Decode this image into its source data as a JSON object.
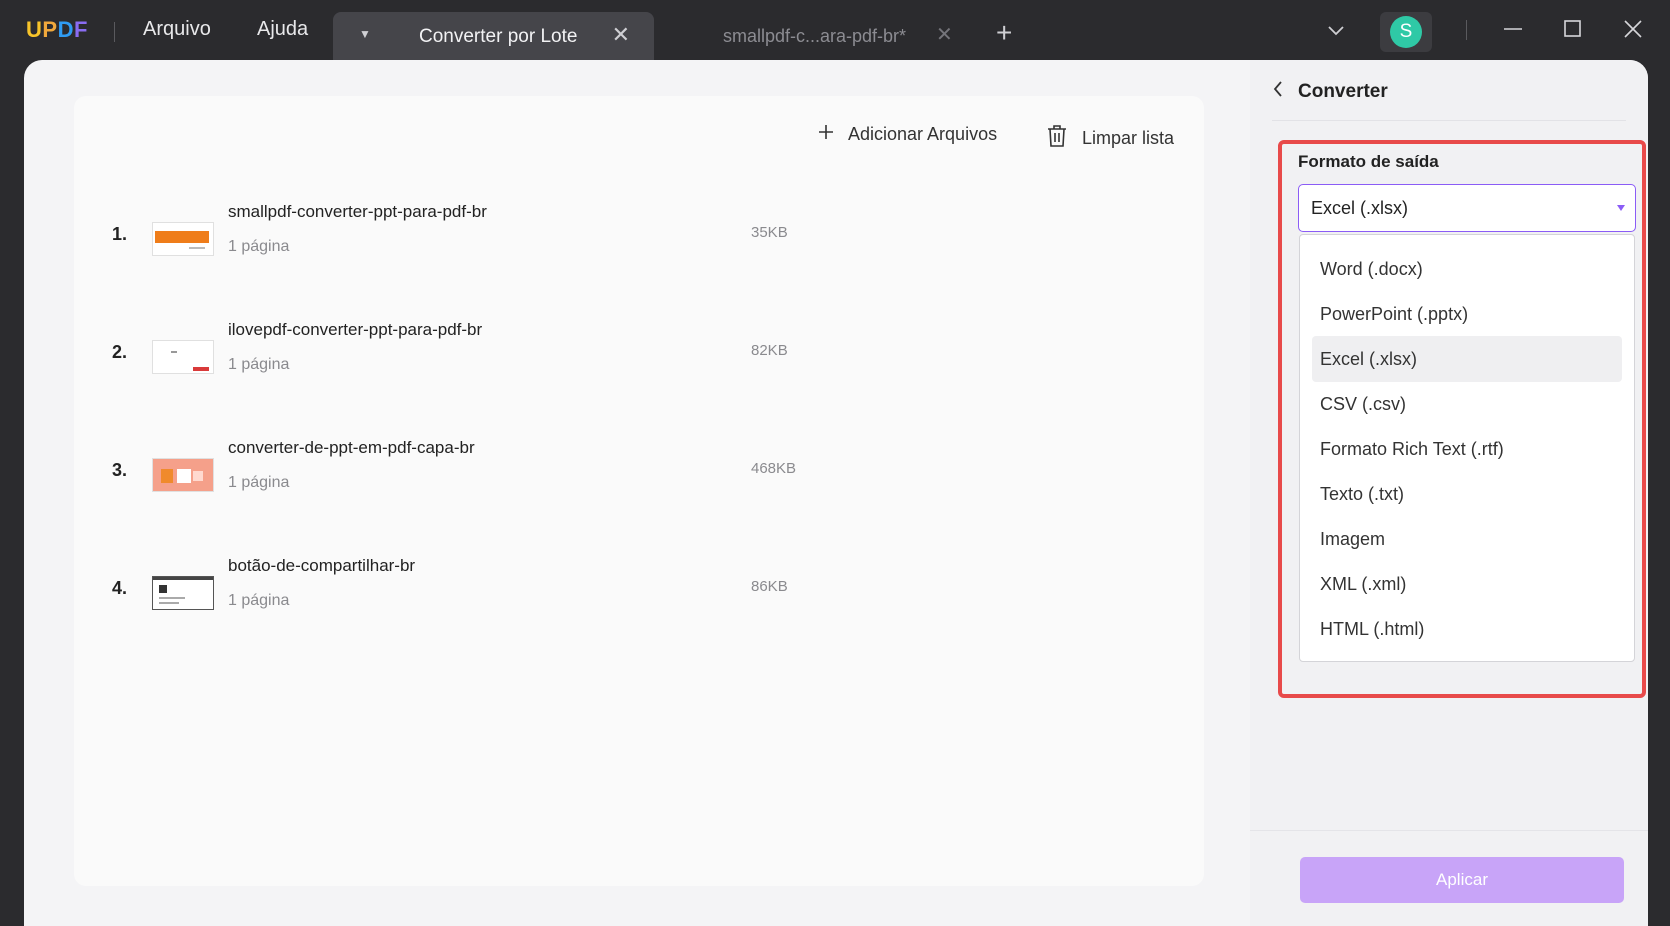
{
  "app": {
    "logo": [
      "U",
      "P",
      "D",
      "F"
    ],
    "menu": [
      "Arquivo",
      "Ajuda"
    ]
  },
  "tabs": {
    "active": "Converter por Lote",
    "inactive": "smallpdf-c...ara-pdf-br*"
  },
  "user": {
    "avatar_letter": "S"
  },
  "toolbar": {
    "add_files": "Adicionar Arquivos",
    "clear_list": "Limpar lista"
  },
  "files": [
    {
      "index": "1.",
      "name": "smallpdf-converter-ppt-para-pdf-br",
      "pages": "1 página",
      "size": "35KB"
    },
    {
      "index": "2.",
      "name": "ilovepdf-converter-ppt-para-pdf-br",
      "pages": "1 página",
      "size": "82KB"
    },
    {
      "index": "3.",
      "name": "converter-de-ppt-em-pdf-capa-br",
      "pages": "1 página",
      "size": "468KB"
    },
    {
      "index": "4.",
      "name": "botão-de-compartilhar-br",
      "pages": "1 página",
      "size": "86KB"
    }
  ],
  "panel": {
    "title": "Converter",
    "format_label": "Formato de saída",
    "selected_format": "Excel (.xlsx)",
    "options": [
      "Word (.docx)",
      "PowerPoint (.pptx)",
      "Excel (.xlsx)",
      "CSV (.csv)",
      "Formato Rich Text (.rtf)",
      "Texto (.txt)",
      "Imagem",
      "XML (.xml)",
      "HTML (.html)"
    ],
    "apply": "Aplicar"
  },
  "colors": {
    "accent": "#8b5cf6",
    "apply_button": "#c8a4f8",
    "highlight_border": "#e84a4a",
    "avatar": "#2fc9a6"
  }
}
